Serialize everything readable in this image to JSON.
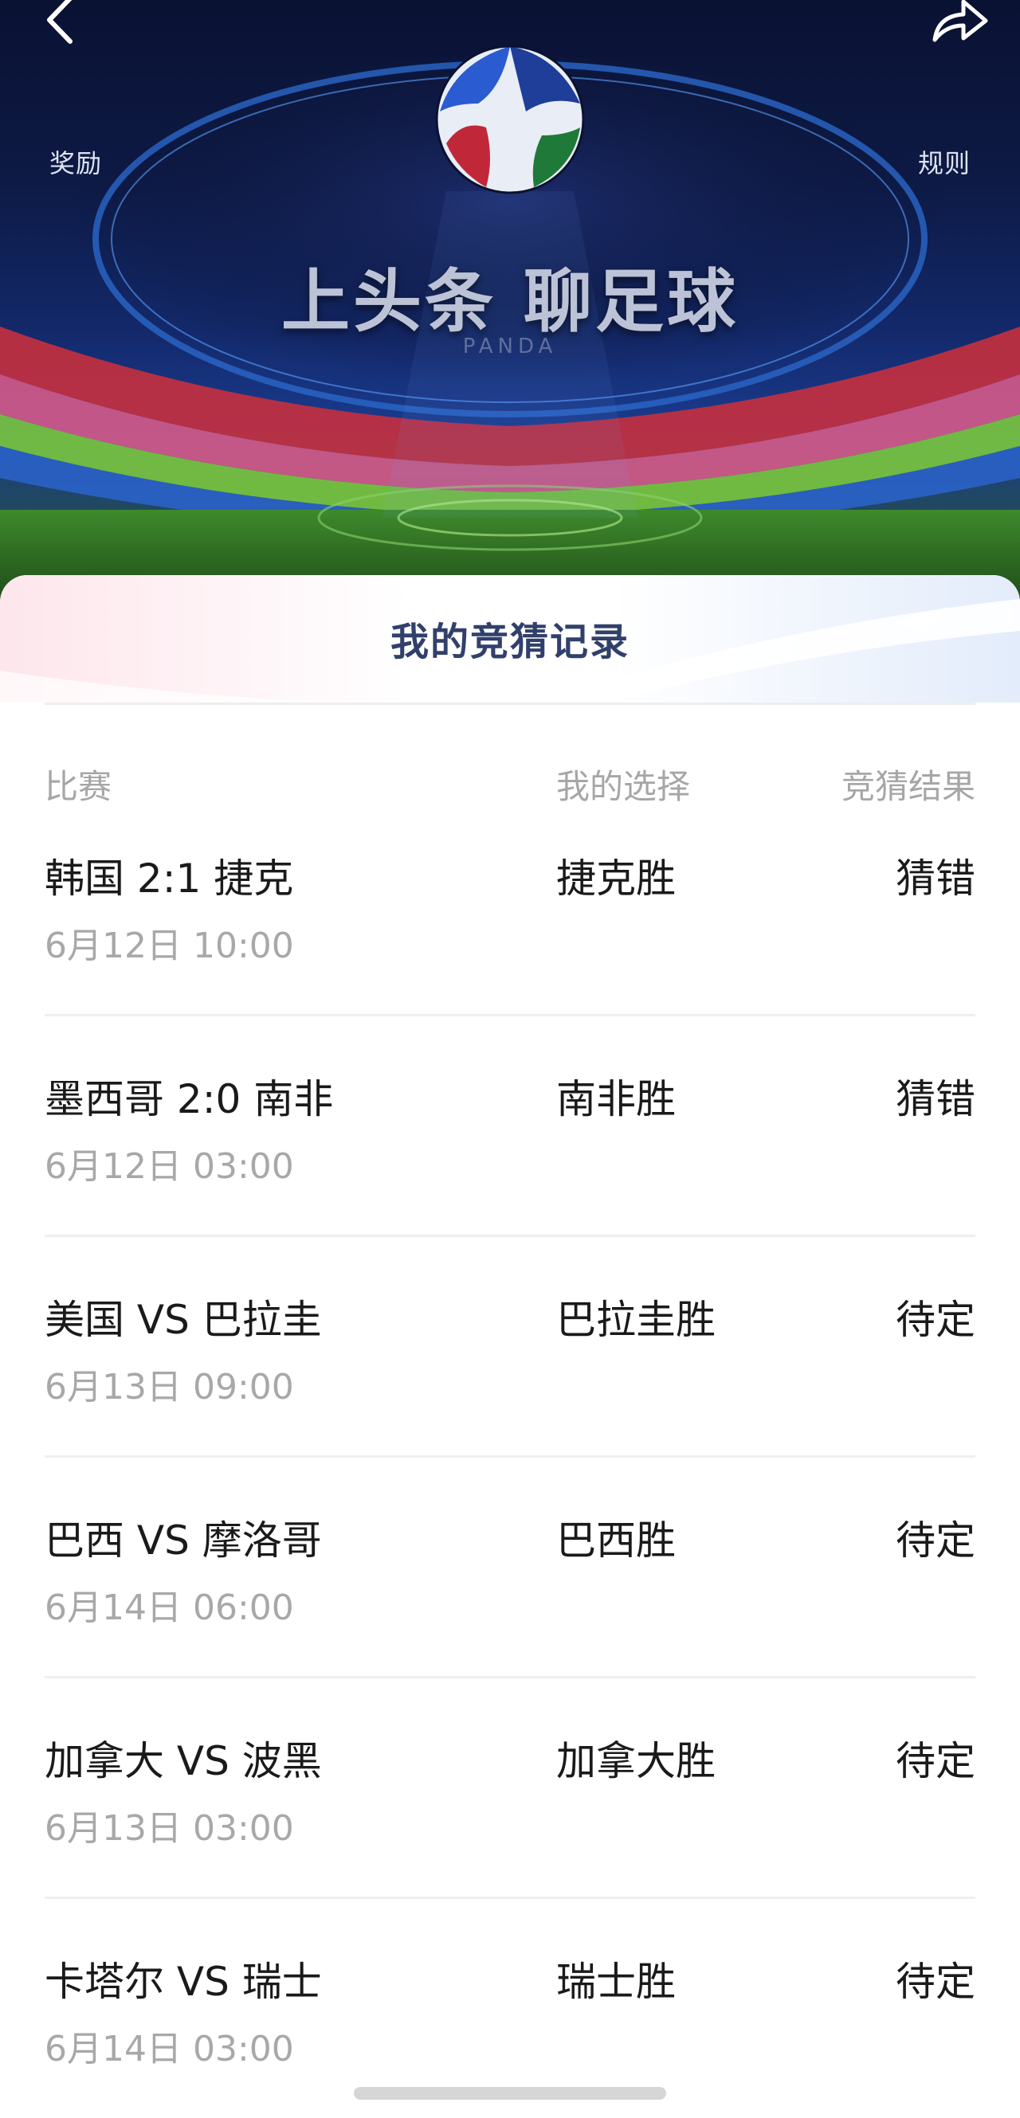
{
  "header": {
    "reward_label": "奖励",
    "rules_label": "规则",
    "banner_title": "上头条 聊足球",
    "banner_subtitle": "PANDA"
  },
  "card": {
    "title": "我的竞猜记录",
    "columns": {
      "match": "比赛",
      "choice": "我的选择",
      "result": "竞猜结果"
    },
    "rows": [
      {
        "match": "韩国 2:1 捷克",
        "time": "6月12日 10:00",
        "choice": "捷克胜",
        "result": "猜错"
      },
      {
        "match": "墨西哥 2:0 南非",
        "time": "6月12日 03:00",
        "choice": "南非胜",
        "result": "猜错"
      },
      {
        "match": "美国 VS 巴拉圭",
        "time": "6月13日 09:00",
        "choice": "巴拉圭胜",
        "result": "待定"
      },
      {
        "match": "巴西 VS 摩洛哥",
        "time": "6月14日 06:00",
        "choice": "巴西胜",
        "result": "待定"
      },
      {
        "match": "加拿大 VS 波黑",
        "time": "6月13日 03:00",
        "choice": "加拿大胜",
        "result": "待定"
      },
      {
        "match": "卡塔尔 VS 瑞士",
        "time": "6月14日 03:00",
        "choice": "瑞士胜",
        "result": "待定"
      }
    ]
  },
  "icons": {
    "back": "chevron-left-icon",
    "share": "share-arrow-icon"
  },
  "colors": {
    "title": "#31406b",
    "muted": "#a6a6a6",
    "text": "#1a1a1a"
  }
}
